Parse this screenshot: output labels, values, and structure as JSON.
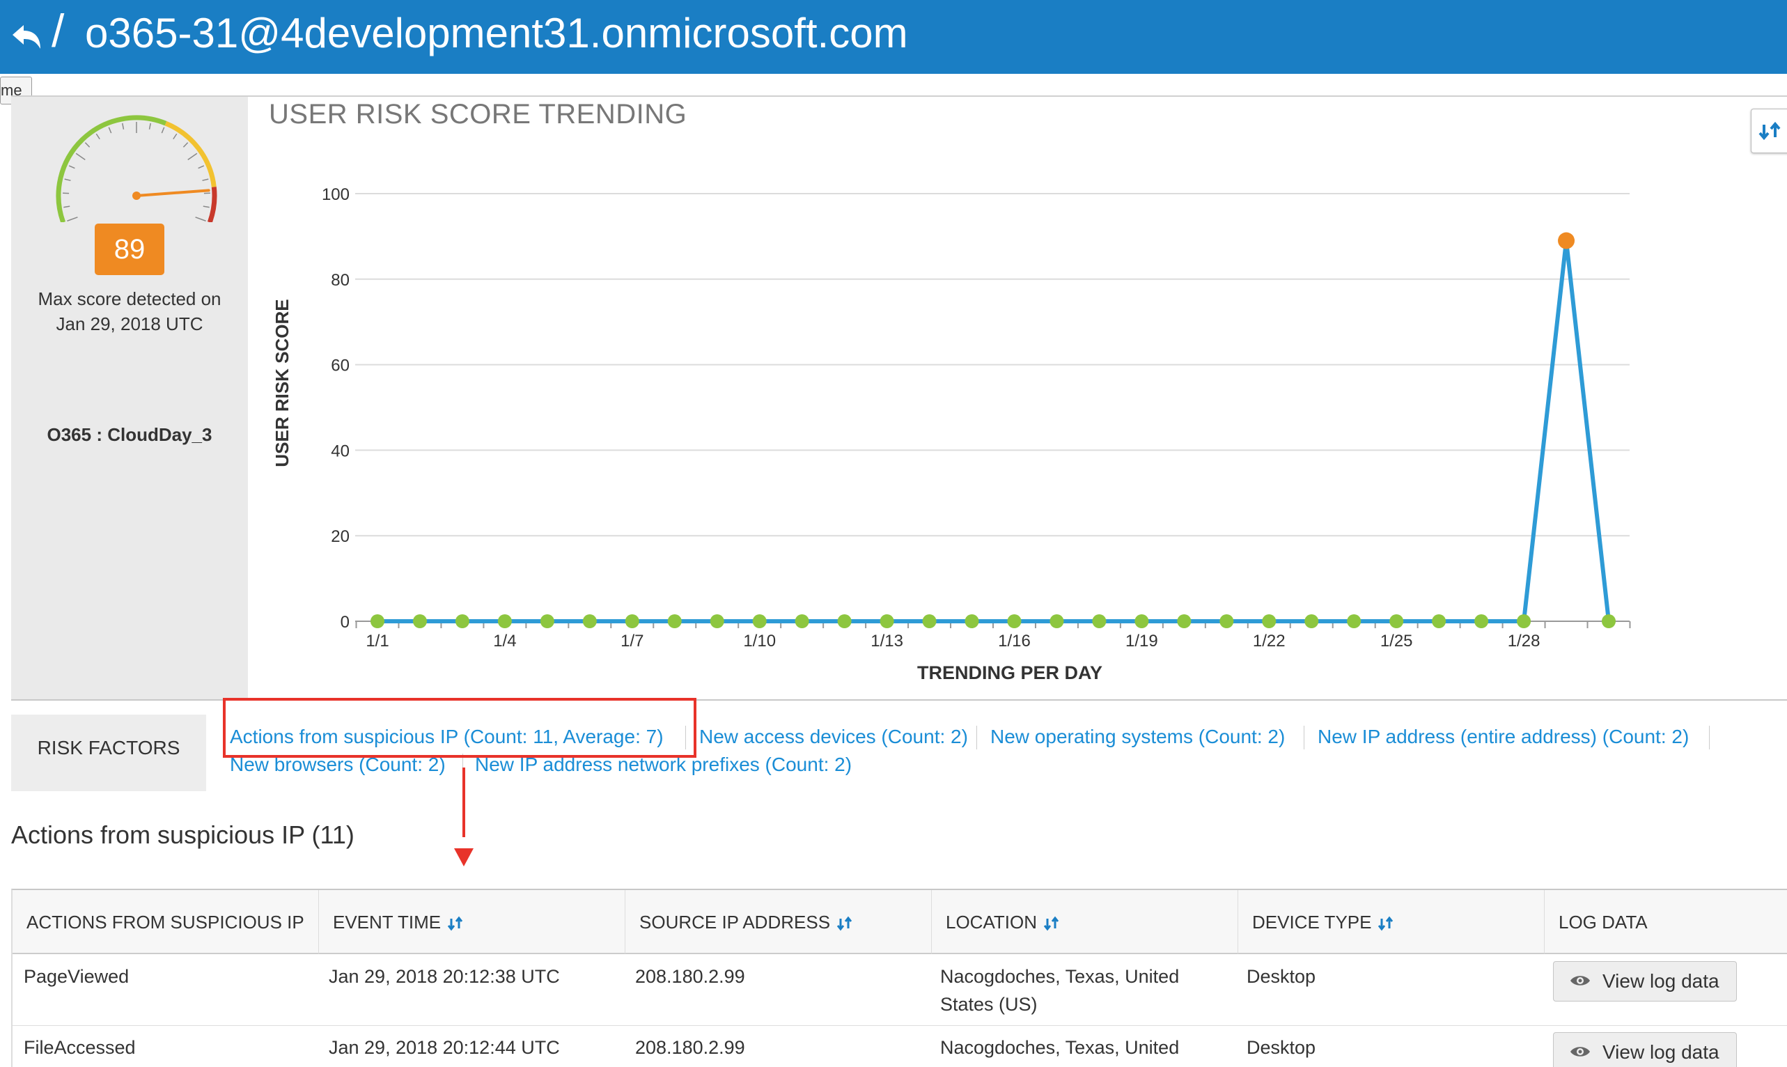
{
  "header": {
    "slash": "/",
    "title": "o365-31@4development31.onmicrosoft.com",
    "tooltip": "me"
  },
  "score_panel": {
    "score": "89",
    "max_text_line1": "Max score detected on",
    "max_text_line2": "Jan 29, 2018 UTC",
    "source_name": "O365 : CloudDay_3",
    "gauge_value": 89
  },
  "chart_data": {
    "type": "line",
    "title": "USER RISK SCORE TRENDING",
    "xlabel": "TRENDING PER DAY",
    "ylabel": "USER RISK SCORE",
    "ylim": [
      0,
      100
    ],
    "yticks": [
      0,
      20,
      40,
      60,
      80,
      100
    ],
    "x": [
      "1/1",
      "1/2",
      "1/3",
      "1/4",
      "1/5",
      "1/6",
      "1/7",
      "1/8",
      "1/9",
      "1/10",
      "1/11",
      "1/12",
      "1/13",
      "1/14",
      "1/15",
      "1/16",
      "1/17",
      "1/18",
      "1/19",
      "1/20",
      "1/21",
      "1/22",
      "1/23",
      "1/24",
      "1/25",
      "1/26",
      "1/27",
      "1/28",
      "1/29",
      "1/30"
    ],
    "xtick_labels": [
      "1/1",
      "1/4",
      "1/7",
      "1/10",
      "1/13",
      "1/16",
      "1/19",
      "1/22",
      "1/25",
      "1/28"
    ],
    "values": [
      0,
      0,
      0,
      0,
      0,
      0,
      0,
      0,
      0,
      0,
      0,
      0,
      0,
      0,
      0,
      0,
      0,
      0,
      0,
      0,
      0,
      0,
      0,
      0,
      0,
      0,
      0,
      0,
      89,
      0
    ],
    "line_color": "#2e9bd6",
    "point_color": "#8dc63f",
    "max_point_color": "#ef8a22",
    "grid": true
  },
  "risk_factors": {
    "label": "RISK FACTORS",
    "links": [
      "Actions from suspicious IP (Count: 11, Average: 7)",
      "New access devices (Count: 2)",
      "New operating systems (Count: 2)",
      "New IP address (entire address) (Count: 2)",
      "New browsers (Count: 2)",
      "New IP address network prefixes (Count: 2)"
    ]
  },
  "section": {
    "heading": "Actions from suspicious IP (11)"
  },
  "table": {
    "headers": [
      "ACTIONS FROM SUSPICIOUS IP",
      "EVENT TIME",
      "SOURCE IP ADDRESS",
      "LOCATION",
      "DEVICE TYPE",
      "LOG DATA"
    ],
    "rows": [
      {
        "action": "PageViewed",
        "time": "Jan 29, 2018 20:12:38 UTC",
        "ip": "208.180.2.99",
        "location_l1": "Nacogdoches, Texas, United",
        "location_l2": "States (US)",
        "device": "Desktop",
        "log": "View log data"
      },
      {
        "action": "FileAccessed",
        "time": "Jan 29, 2018 20:12:44 UTC",
        "ip": "208.180.2.99",
        "location_l1": "Nacogdoches, Texas, United",
        "location_l2": "",
        "device": "Desktop",
        "log": "View log data"
      }
    ]
  },
  "colors": {
    "header_bg": "#1a7ec4",
    "link": "#1a8dd6",
    "badge": "#ef8a22",
    "annotation": "#e8332a"
  }
}
